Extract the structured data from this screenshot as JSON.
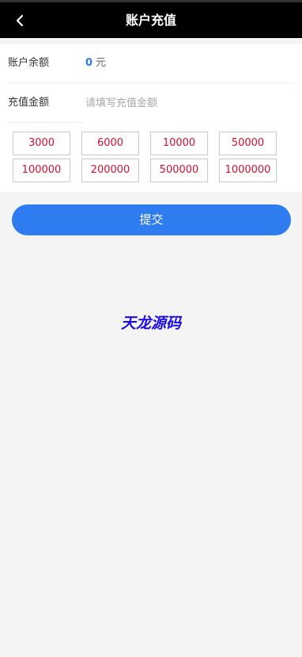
{
  "header": {
    "title": "账户充值",
    "back_icon": "chevron-left-icon"
  },
  "balance": {
    "label": "账户余额",
    "value": "0",
    "unit": "元"
  },
  "amount": {
    "label": "充值金额",
    "placeholder": "请填写充值金额",
    "value": ""
  },
  "presets": [
    "3000",
    "6000",
    "10000",
    "50000",
    "100000",
    "200000",
    "500000",
    "1000000"
  ],
  "submit": {
    "label": "提交"
  },
  "watermark": {
    "text": "天龙源码"
  },
  "colors": {
    "header_bg": "#000000",
    "accent": "#2f7bf0",
    "preset_text": "#d0102e",
    "watermark": "#1d0de4",
    "page_bg": "#f4f4f4"
  }
}
